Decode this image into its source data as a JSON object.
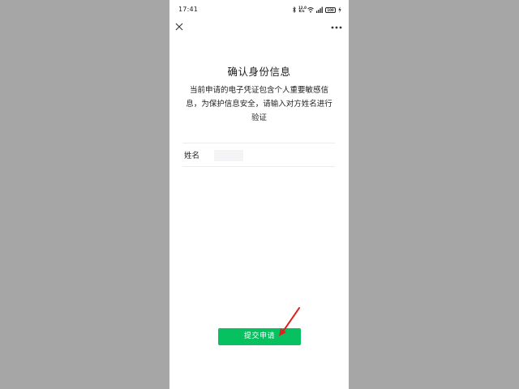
{
  "status_bar": {
    "time": "17:41",
    "net_speed": "12.0 K/s",
    "battery": "100",
    "icons": [
      "bluetooth-icon",
      "wifi-icon",
      "signal-icon",
      "battery-icon",
      "charging-icon"
    ]
  },
  "nav": {
    "close_icon": "close-icon",
    "more_icon": "more-icon"
  },
  "page": {
    "title": "确认身份信息",
    "description": "当前申请的电子凭证包含个人重要敏感信息，为保护信息安全，请输入对方姓名进行验证"
  },
  "form": {
    "name_label": "姓名",
    "name_value": "",
    "name_placeholder": ""
  },
  "actions": {
    "submit_label": "提交申请"
  },
  "colors": {
    "background": "#a6a6a6",
    "panel": "#ffffff",
    "primary": "#07c160",
    "annotation": "#e02020"
  }
}
